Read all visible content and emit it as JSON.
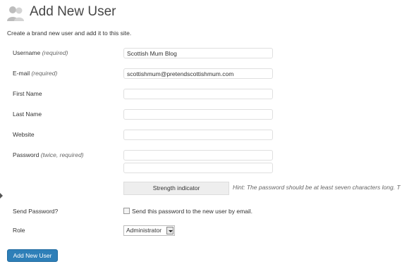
{
  "header": {
    "title": "Add New User",
    "icon": "users-icon"
  },
  "intro": "Create a brand new user and add it to this site.",
  "form": {
    "username": {
      "label": "Username",
      "note": "(required)",
      "value": "Scottish Mum Blog"
    },
    "email": {
      "label": "E-mail",
      "note": "(required)",
      "value": "scottishmum@pretendscottishmum.com"
    },
    "first_name": {
      "label": "First Name",
      "value": ""
    },
    "last_name": {
      "label": "Last Name",
      "value": ""
    },
    "website": {
      "label": "Website",
      "value": ""
    },
    "password": {
      "label": "Password",
      "note": "(twice, required)",
      "value1": "",
      "value2": ""
    },
    "strength_indicator": "Strength indicator",
    "hint": "Hint: The password should be at least seven characters long. T",
    "send_password": {
      "label": "Send Password?",
      "checkbox_label": "Send this password to the new user by email.",
      "checked": false
    },
    "role": {
      "label": "Role",
      "selected": "Administrator"
    },
    "submit_label": "Add New User"
  },
  "colors": {
    "primary_button": "#2e7fb8",
    "title": "#464646"
  }
}
